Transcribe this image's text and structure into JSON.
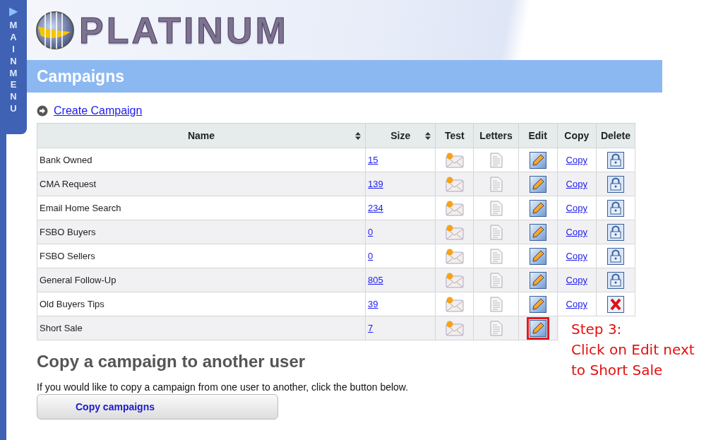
{
  "sidebar_tab": {
    "arrow": "▶",
    "label": "MAIN MENU"
  },
  "logo": {
    "text": "PLATINUM"
  },
  "page_title": "Campaigns",
  "create_link": "Create Campaign",
  "table": {
    "columns": [
      {
        "label": "Name",
        "sortable": true
      },
      {
        "label": "Size",
        "sortable": true
      },
      {
        "label": "Test",
        "sortable": false
      },
      {
        "label": "Letters",
        "sortable": false
      },
      {
        "label": "Edit",
        "sortable": false
      },
      {
        "label": "Copy",
        "sortable": false
      },
      {
        "label": "Delete",
        "sortable": false
      }
    ],
    "rows": [
      {
        "name": "Bank Owned",
        "size": "15",
        "copy": "Copy",
        "delete_locked": true,
        "highlighted": false
      },
      {
        "name": "CMA Request",
        "size": "139",
        "copy": "Copy",
        "delete_locked": true,
        "highlighted": false
      },
      {
        "name": "Email Home Search",
        "size": "234",
        "copy": "Copy",
        "delete_locked": true,
        "highlighted": false
      },
      {
        "name": "FSBO Buyers",
        "size": "0",
        "copy": "Copy",
        "delete_locked": true,
        "highlighted": false
      },
      {
        "name": "FSBO Sellers",
        "size": "0",
        "copy": "Copy",
        "delete_locked": true,
        "highlighted": false
      },
      {
        "name": "General Follow-Up",
        "size": "805",
        "copy": "Copy",
        "delete_locked": true,
        "highlighted": false
      },
      {
        "name": "Old Buyers Tips",
        "size": "39",
        "copy": "Copy",
        "delete_locked": false,
        "highlighted": false
      },
      {
        "name": "Short Sale",
        "size": "7",
        "highlighted": true
      }
    ]
  },
  "copy_section": {
    "heading": "Copy a campaign to another user",
    "text": "If you would like to copy a campaign from one user to another, click the button below.",
    "button": "Copy campaigns"
  },
  "annotation": {
    "lines": [
      "Step 3:",
      "Click on Edit next",
      "to Short Sale"
    ]
  }
}
